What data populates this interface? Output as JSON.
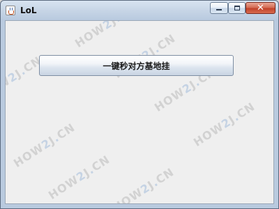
{
  "window": {
    "title": "LoL"
  },
  "titlebar": {
    "close_glyph": "✕",
    "icons": {
      "app": "java-cup-icon",
      "minimize": "minimize-icon",
      "maximize": "maximize-icon",
      "close": "close-icon"
    }
  },
  "main": {
    "button_label": "一键秒对方基地挂"
  },
  "watermark": {
    "parts": [
      "HOW",
      "2",
      "J",
      ".",
      "CN"
    ]
  }
}
